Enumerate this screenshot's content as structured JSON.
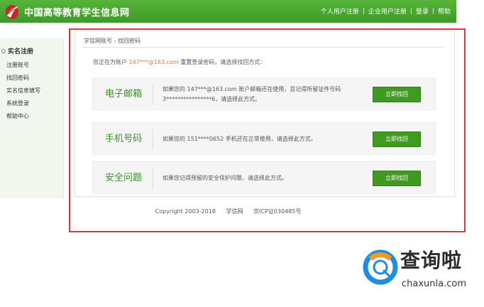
{
  "header": {
    "site_title": "中国高等教育学生信息网",
    "nav": [
      "个人用户注册",
      "企业用户注册",
      "登录",
      "帮助"
    ],
    "nav_separator": "|"
  },
  "sidebar": {
    "section_title": "实名注册",
    "items": [
      {
        "label": "注册账号"
      },
      {
        "label": "找回密码"
      },
      {
        "label": "实名信息填写"
      },
      {
        "label": "系统登录"
      },
      {
        "label": "帮助中心"
      }
    ]
  },
  "main": {
    "breadcrumb": "学信网账号 - 找回密码",
    "intro_prefix": "您正在为账户",
    "account": "147***@163.com",
    "intro_suffix": "重置登录密码，请选择找回方式：",
    "options": [
      {
        "name": "电子邮箱",
        "desc_line1": "如果您的 147***@163.com 账户邮箱还在使用，且记得所留证件号码",
        "desc_line2": "3****************6，请选择此方式。",
        "button": "立即找回"
      },
      {
        "name": "手机号码",
        "desc_line1": "如果您的 151****0652 手机还在正常使用，请选择此方式。",
        "desc_line2": "",
        "button": "立即找回"
      },
      {
        "name": "安全问题",
        "desc_line1": "如果您记得预留的安全保护问题，请选择此方式。",
        "desc_line2": "",
        "button": "立即找回"
      }
    ]
  },
  "footer": {
    "copyright": "Copyright 2003-2018",
    "site": "学信网",
    "icp": "京ICP证030485号"
  },
  "watermark": {
    "brand": "查询啦",
    "url": "chaxunla.com"
  },
  "colors": {
    "header_green": "#3d9a27",
    "button_green": "#3f9a1f",
    "option_title": "#3a8f2a",
    "account_orange": "#e07a3d",
    "highlight_red": "#d9393d",
    "watermark_blue": "#1f8ee0",
    "watermark_orange": "#f39a1e"
  }
}
